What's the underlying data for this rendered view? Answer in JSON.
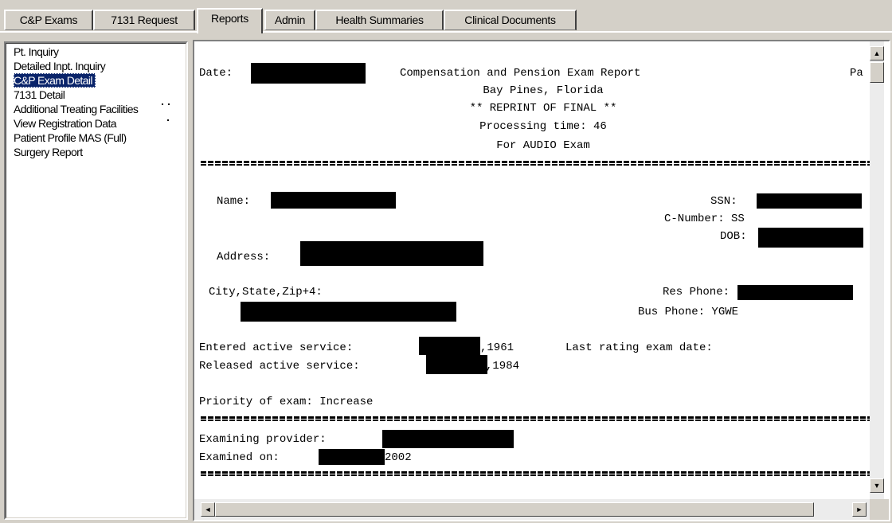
{
  "tabs": [
    {
      "label": "C&P Exams",
      "active": false
    },
    {
      "label": "7131 Request",
      "active": false
    },
    {
      "label": "Reports",
      "active": true
    },
    {
      "label": "Admin",
      "active": false
    },
    {
      "label": "Health Summaries",
      "active": false
    },
    {
      "label": "Clinical Documents",
      "active": false
    }
  ],
  "report_list": {
    "items": [
      {
        "label": "Pt. Inquiry",
        "selected": false
      },
      {
        "label": "Detailed Inpt. Inquiry",
        "selected": false
      },
      {
        "label": "C&P Exam Detail",
        "selected": true
      },
      {
        "label": "7131 Detail",
        "selected": false
      },
      {
        "label": "Additional Treating Facilities",
        "selected": false
      },
      {
        "label": "View Registration Data",
        "selected": false
      },
      {
        "label": "Patient Profile MAS (Full)",
        "selected": false
      },
      {
        "label": "Surgery Report",
        "selected": false
      }
    ]
  },
  "report": {
    "date_label": "Date:",
    "title": "Compensation and Pension Exam Report",
    "page_label": "Pa",
    "location": "Bay Pines, Florida",
    "reprint": "** REPRINT OF FINAL **",
    "processing_time": "Processing time: 46",
    "exam_type": "For AUDIO Exam",
    "name_label": "Name:",
    "ssn_label": "SSN:",
    "c_number": "C-Number: SS",
    "dob_label": "DOB:",
    "address_label": "Address:",
    "city_label": "City,State,Zip+4:",
    "res_phone_label": "Res Phone:",
    "bus_phone": "Bus Phone: YGWE",
    "entered_label": "Entered active service:",
    "entered_year": ",1961",
    "last_rating_label": "Last rating exam date:",
    "released_label": "Released active service:",
    "released_year": ",1984",
    "priority": "Priority of exam: Increase",
    "provider_label": "Examining provider:",
    "examined_label": "Examined on:",
    "examined_year": "2002"
  },
  "scrollbars": {
    "up_arrow": "▲",
    "down_arrow": "▼",
    "left_arrow": "◄",
    "right_arrow": "►"
  }
}
